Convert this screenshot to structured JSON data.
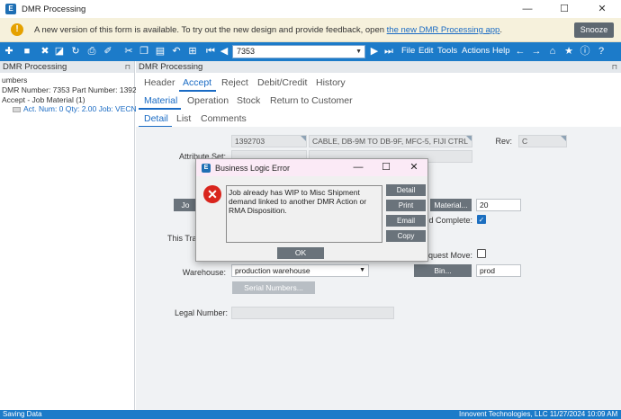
{
  "window": {
    "title": "DMR Processing",
    "minimize": "—",
    "maximize": "☐",
    "close": "✕"
  },
  "banner": {
    "message": "A new version of this form is available. To try out the new design and provide feedback, open ",
    "link": "the new DMR Processing app",
    "suffix": ".",
    "snooze_label": "Snooze"
  },
  "toolbar": {
    "key_value": "7353",
    "menus": [
      "File",
      "Edit",
      "Tools",
      "Actions",
      "Help"
    ]
  },
  "tree": {
    "title": "DMR Processing",
    "line1": "umbers",
    "line2": "DMR Number: 7353 Part Number: 139270",
    "line3": "Accept - Job Material (1)",
    "line4": "Act. Num: 0 Qty: 2.00 Job: VECN-"
  },
  "main": {
    "title": "DMR Processing",
    "tabs_top": [
      "Header",
      "Accept",
      "Reject",
      "Debit/Credit",
      "History"
    ],
    "tabs_mid": [
      "Material",
      "Operation",
      "Stock",
      "Return to Customer"
    ],
    "tabs_low": [
      "Detail",
      "List",
      "Comments"
    ]
  },
  "form": {
    "part_label": "Part:",
    "part_value": "1392703",
    "part_desc": "CABLE, DB-9M TO DB-9F, MFC-5, FIJI CTRL",
    "rev_label": "Rev:",
    "rev_value": "C",
    "attribute_label": "Attribute Set:",
    "job_btn": "Jo",
    "material_btn": "Material...",
    "material_value": "20",
    "completed_label": "ed Complete:",
    "this_tra_label": "This Tra",
    "request_move_label": "equest Move:",
    "warehouse_label": "Warehouse:",
    "warehouse_value": "production warehouse",
    "bin_btn": "Bin...",
    "bin_value": "prod",
    "serial_btn": "Serial Numbers...",
    "legal_label": "Legal Number:"
  },
  "dialog": {
    "title": "Business Logic Error",
    "message": "Job already has WIP to Misc Shipment demand linked to another DMR Action or RMA Disposition.",
    "buttons": [
      "Detail",
      "Print",
      "Email",
      "Copy"
    ],
    "ok": "OK"
  },
  "status": {
    "left": "Saving Data",
    "right": "Innovent Technologies, LLC  11/27/2024   10:09 AM"
  }
}
